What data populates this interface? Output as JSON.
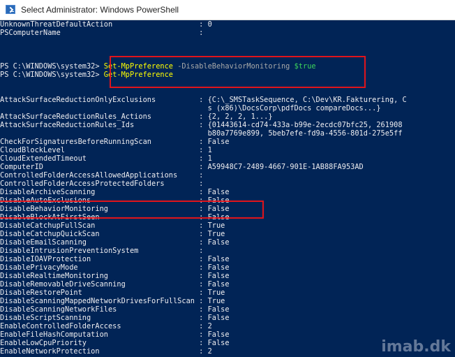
{
  "window": {
    "title": "Select Administrator: Windows PowerShell",
    "icon": "powershell-icon"
  },
  "colors": {
    "console_bg": "#012456",
    "text": "#eeedf0",
    "command": "#ffff00",
    "parameter": "#a8a8a8",
    "variable": "#3cd45b",
    "highlight_box": "#e0141b"
  },
  "console": {
    "top": [
      {
        "name": "UnknownThreatDefaultAction",
        "value": "0"
      },
      {
        "name": "PSComputerName",
        "value": ""
      }
    ],
    "commands": [
      {
        "prompt": "PS C:\\WINDOWS\\system32>",
        "cmdlet": "Set-MpPreference",
        "param": "-DisableBehaviorMonitoring",
        "arg": "$true"
      },
      {
        "prompt": "PS C:\\WINDOWS\\system32>",
        "cmdlet": "Get-MpPreference",
        "param": "",
        "arg": ""
      }
    ],
    "asr_exclusions": {
      "name": "AttackSurfaceReductionOnlyExclusions",
      "value": "{C:\\_SMSTaskSequence, C:\\Dev\\KR.Fakturering, C",
      "continuation": "s (x86)\\DocsCorp\\pdfDocs compareDocs...}"
    },
    "asr_actions": {
      "name": "AttackSurfaceReductionRules_Actions",
      "value": "{2, 2, 2, 1...}"
    },
    "asr_ids": {
      "name": "AttackSurfaceReductionRules_Ids",
      "value": "{01443614-cd74-433a-b99e-2ecdc07bfc25, 261908",
      "continuation": "b80a7769e899, 5beb7efe-fd9a-4556-801d-275e5ff"
    },
    "settings": [
      {
        "name": "CheckForSignaturesBeforeRunningScan",
        "value": "False"
      },
      {
        "name": "CloudBlockLevel",
        "value": "1"
      },
      {
        "name": "CloudExtendedTimeout",
        "value": "1"
      },
      {
        "name": "ComputerID",
        "value": "A59948C7-2489-4667-901E-1AB88FA953AD"
      },
      {
        "name": "ControlledFolderAccessAllowedApplications",
        "value": ""
      },
      {
        "name": "ControlledFolderAccessProtectedFolders",
        "value": ""
      },
      {
        "name": "DisableArchiveScanning",
        "value": "False"
      },
      {
        "name": "DisableAutoExclusions",
        "value": "False"
      },
      {
        "name": "DisableBehaviorMonitoring",
        "value": "False"
      },
      {
        "name": "DisableBlockAtFirstSeen",
        "value": "False"
      },
      {
        "name": "DisableCatchupFullScan",
        "value": "True"
      },
      {
        "name": "DisableCatchupQuickScan",
        "value": "True"
      },
      {
        "name": "DisableEmailScanning",
        "value": "False"
      },
      {
        "name": "DisableIntrusionPreventionSystem",
        "value": ""
      },
      {
        "name": "DisableIOAVProtection",
        "value": "False"
      },
      {
        "name": "DisablePrivacyMode",
        "value": "False"
      },
      {
        "name": "DisableRealtimeMonitoring",
        "value": "False"
      },
      {
        "name": "DisableRemovableDriveScanning",
        "value": "False"
      },
      {
        "name": "DisableRestorePoint",
        "value": "True"
      },
      {
        "name": "DisableScanningMappedNetworkDrivesForFullScan",
        "value": "True"
      },
      {
        "name": "DisableScanningNetworkFiles",
        "value": "False"
      },
      {
        "name": "DisableScriptScanning",
        "value": "False"
      },
      {
        "name": "EnableControlledFolderAccess",
        "value": "2"
      },
      {
        "name": "EnableFileHashComputation",
        "value": "False"
      },
      {
        "name": "EnableLowCpuPriority",
        "value": "False"
      },
      {
        "name": "EnableNetworkProtection",
        "value": "2"
      }
    ]
  },
  "watermark": "imab.dk"
}
